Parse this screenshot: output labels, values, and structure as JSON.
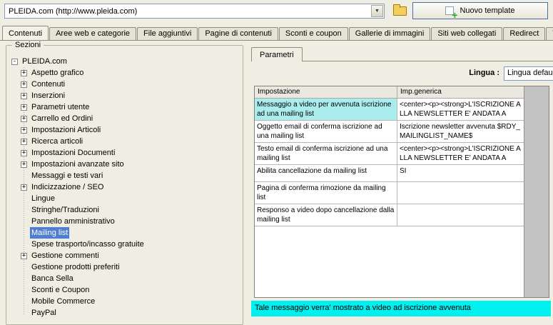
{
  "colors": {
    "window_background": "#f0eee2",
    "selection_blue": "#4f7dcf",
    "row_highlight_cyan": "#abecec",
    "footer_cyan": "#00efef",
    "unused_column_gray": "#c2c2c2",
    "plus_green": "#1fae1f",
    "folder_yellow": "#f2cf5f"
  },
  "toolbar": {
    "site_combo_value": "PLEIDA.com (http://www.pleida.com)",
    "new_template_button": "Nuovo template"
  },
  "tabs": {
    "active": "Contenuti",
    "items": [
      "Contenuti",
      "Aree web e categorie",
      "File aggiuntivi",
      "Pagine di contenuti",
      "Sconti e coupon",
      "Gallerie di immagini",
      "Siti web collegati",
      "Redirect",
      "Template e p"
    ]
  },
  "sidebar": {
    "group_label": "Sezioni",
    "tree": {
      "root": "PLEIDA.com",
      "items": [
        {
          "label": "Aspetto grafico",
          "has_children": true
        },
        {
          "label": "Contenuti",
          "has_children": true
        },
        {
          "label": "Inserzioni",
          "has_children": true
        },
        {
          "label": "Parametri utente",
          "has_children": true
        },
        {
          "label": "Carrello ed Ordini",
          "has_children": true
        },
        {
          "label": "Impostazioni Articoli",
          "has_children": true
        },
        {
          "label": "Ricerca articoli",
          "has_children": true
        },
        {
          "label": "Impostazioni Documenti",
          "has_children": true
        },
        {
          "label": "Impostazioni avanzate sito",
          "has_children": true
        },
        {
          "label": "Messaggi e testi vari",
          "has_children": false
        },
        {
          "label": "Indicizzazione / SEO",
          "has_children": true
        },
        {
          "label": "Lingue",
          "has_children": false
        },
        {
          "label": "Stringhe/Traduzioni",
          "has_children": false
        },
        {
          "label": "Pannello amministrativo",
          "has_children": false
        },
        {
          "label": "Mailing list",
          "has_children": false,
          "selected": true
        },
        {
          "label": "Spese trasporto/incasso gratuite",
          "has_children": false
        },
        {
          "label": "Gestione commenti",
          "has_children": true
        },
        {
          "label": "Gestione prodotti preferiti",
          "has_children": false
        },
        {
          "label": "Banca Sella",
          "has_children": false
        },
        {
          "label": "Sconti e Coupon",
          "has_children": false
        },
        {
          "label": "Mobile Commerce",
          "has_children": false
        },
        {
          "label": "PayPal",
          "has_children": false
        }
      ]
    }
  },
  "content": {
    "panel_tab": "Parametri",
    "language_label": "Lingua :",
    "language_value": "Lingua default",
    "table": {
      "columns": [
        "Impostazione",
        "Imp.generica"
      ],
      "rows": [
        {
          "setting": "Messaggio a video per avvenuta iscrizione ad una mailing list",
          "value": "<center><p><strong>L'ISCRIZIONE ALLA NEWSLETTER E' ANDATA A",
          "highlighted": true
        },
        {
          "setting": "Oggetto email di conferma iscrizione ad una mailing list",
          "value": "Iscrizione newsletter avvenuta $RDY_MAILINGLIST_NAME$",
          "highlighted": false
        },
        {
          "setting": "Testo email di conferma iscrizione ad una mailing list",
          "value": "<center><p><strong>L'ISCRIZIONE ALLA NEWSLETTER E' ANDATA A",
          "highlighted": false
        },
        {
          "setting": "Abilita cancellazione da mailing list",
          "value": "SI",
          "highlighted": false
        },
        {
          "setting": "Pagina di conferma rimozione da mailing list",
          "value": "",
          "highlighted": false
        },
        {
          "setting": "Responso a video dopo cancellazione dalla mailing list",
          "value": "",
          "highlighted": false
        }
      ]
    },
    "footer_message": "Tale messaggio verra' mostrato a video ad iscrizione avvenuta"
  }
}
